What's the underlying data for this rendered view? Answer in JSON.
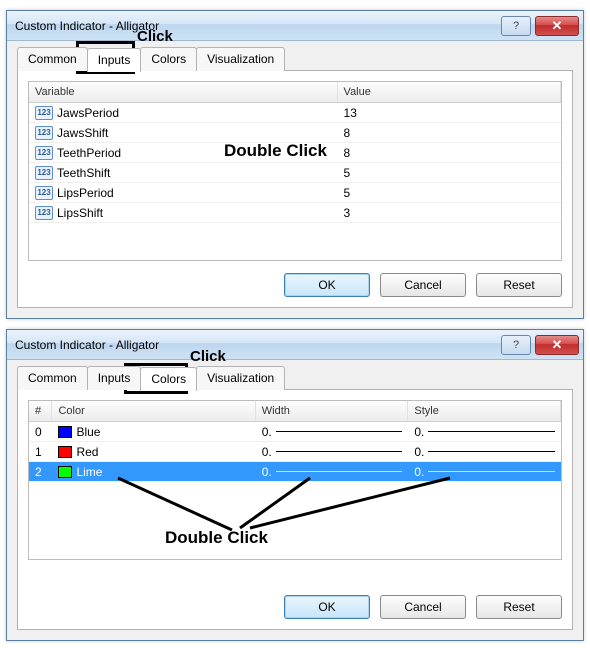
{
  "dialog1": {
    "title": "Custom Indicator - Alligator",
    "tabs": [
      "Common",
      "Inputs",
      "Colors",
      "Visualization"
    ],
    "activeTab": 1,
    "headers": {
      "variable": "Variable",
      "value": "Value"
    },
    "rows": [
      {
        "name": "JawsPeriod",
        "value": "13"
      },
      {
        "name": "JawsShift",
        "value": "8"
      },
      {
        "name": "TeethPeriod",
        "value": "8"
      },
      {
        "name": "TeethShift",
        "value": "5"
      },
      {
        "name": "LipsPeriod",
        "value": "5"
      },
      {
        "name": "LipsShift",
        "value": "3"
      }
    ],
    "buttons": {
      "ok": "OK",
      "cancel": "Cancel",
      "reset": "Reset"
    }
  },
  "dialog2": {
    "title": "Custom Indicator - Alligator",
    "tabs": [
      "Common",
      "Inputs",
      "Colors",
      "Visualization"
    ],
    "activeTab": 2,
    "headers": {
      "index": "#",
      "color": "Color",
      "width": "Width",
      "style": "Style"
    },
    "rows": [
      {
        "idx": "0",
        "colorName": "Blue",
        "swatch": "#0000ff",
        "width": "0.",
        "style": "0.",
        "selected": false
      },
      {
        "idx": "1",
        "colorName": "Red",
        "swatch": "#ff0000",
        "width": "0.",
        "style": "0.",
        "selected": false
      },
      {
        "idx": "2",
        "colorName": "Lime",
        "swatch": "#00ff00",
        "width": "0.",
        "style": "0.",
        "selected": true
      }
    ],
    "buttons": {
      "ok": "OK",
      "cancel": "Cancel",
      "reset": "Reset"
    }
  },
  "annotations": {
    "click1": "Click",
    "doubleClick1": "Double Click",
    "click2": "Click",
    "doubleClick2": "Double Click"
  },
  "icons": {
    "varIcon": "123",
    "help": "?",
    "close": "✕"
  }
}
